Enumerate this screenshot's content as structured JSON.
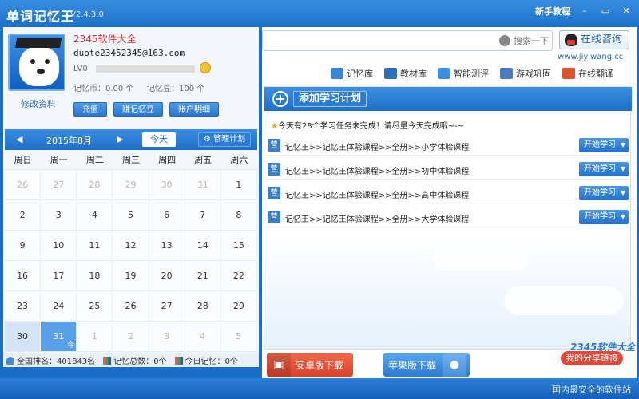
{
  "window": {
    "title": "单词记忆王",
    "version": "V2.4.3.0",
    "tutorial_link": "新手教程",
    "controls": [
      "–",
      "▭",
      "✕"
    ]
  },
  "profile": {
    "username": "2345软件大全",
    "email": "duote23452345@163.com",
    "level_label": "LV0",
    "level_progress": 0.0,
    "coins_label": "记忆币：",
    "coins_value": "0.00 个",
    "beans_label": "记忆豆：",
    "beans_value": "100 个",
    "edit_link": "修改资料",
    "buttons": {
      "recharge": "充值",
      "earn": "赚记忆豆",
      "account": "账户明细"
    }
  },
  "calendar": {
    "prev": "◀",
    "next": "▶",
    "month": "2015年8月",
    "today_button": "今天",
    "manage_button": "管理计划",
    "weekdays": [
      "周日",
      "周一",
      "周二",
      "周三",
      "周四",
      "周五",
      "周六"
    ],
    "days": [
      {
        "d": "26",
        "muted": true
      },
      {
        "d": "27",
        "muted": true
      },
      {
        "d": "28",
        "muted": true
      },
      {
        "d": "29",
        "muted": true
      },
      {
        "d": "30",
        "muted": true
      },
      {
        "d": "31",
        "muted": true
      },
      {
        "d": "1"
      },
      {
        "d": "2"
      },
      {
        "d": "3"
      },
      {
        "d": "4"
      },
      {
        "d": "5"
      },
      {
        "d": "6"
      },
      {
        "d": "7"
      },
      {
        "d": "8"
      },
      {
        "d": "9"
      },
      {
        "d": "10"
      },
      {
        "d": "11"
      },
      {
        "d": "12"
      },
      {
        "d": "13"
      },
      {
        "d": "14"
      },
      {
        "d": "15"
      },
      {
        "d": "16"
      },
      {
        "d": "17"
      },
      {
        "d": "18"
      },
      {
        "d": "19"
      },
      {
        "d": "20"
      },
      {
        "d": "21"
      },
      {
        "d": "22"
      },
      {
        "d": "23"
      },
      {
        "d": "24"
      },
      {
        "d": "25"
      },
      {
        "d": "26"
      },
      {
        "d": "27"
      },
      {
        "d": "28"
      },
      {
        "d": "29"
      },
      {
        "d": "30",
        "sel": true
      },
      {
        "d": "31",
        "today": true
      },
      {
        "d": "1",
        "muted": true
      },
      {
        "d": "2",
        "muted": true
      },
      {
        "d": "3",
        "muted": true
      },
      {
        "d": "4",
        "muted": true
      },
      {
        "d": "5",
        "muted": true
      }
    ]
  },
  "stats": {
    "rank_label": "全国排名：",
    "rank_value": "401843名",
    "total_label": "记忆总数：",
    "total_value": "0个",
    "today_label": "今日记忆：",
    "today_value": "0个"
  },
  "search": {
    "placeholder": "",
    "button": "搜索一下"
  },
  "consult_button": "在线咨询",
  "site_url": "www.jiyiwang.cc",
  "nav": [
    {
      "label": "记忆库",
      "icon": "chart-icon",
      "color": "#3a86d6"
    },
    {
      "label": "教材库",
      "icon": "book-icon",
      "color": "#2f6fb8"
    },
    {
      "label": "智能测评",
      "icon": "thumb-icon",
      "color": "#3b8fe0"
    },
    {
      "label": "游戏巩固",
      "icon": "gamepad-icon",
      "color": "#4a7bc0"
    },
    {
      "label": "在线翻译",
      "icon": "person-icon",
      "color": "#d9542e"
    }
  ],
  "plan": {
    "add_button": "添加学习计划",
    "notice_star": "★",
    "notice": "今天有28个学习任务未完成！请尽量今天完成哦~-~",
    "rows": [
      {
        "tag": "营",
        "path": "记忆王>>记忆王体验课程>>全册>>小学体验课程",
        "button": "开始学习"
      },
      {
        "tag": "营",
        "path": "记忆王>>记忆王体验课程>>全册>>初中体验课程",
        "button": "开始学习"
      },
      {
        "tag": "营",
        "path": "记忆王>>记忆王体验课程>>全册>>高中体验课程",
        "button": "开始学习"
      },
      {
        "tag": "营",
        "path": "记忆王>>记忆王体验课程>>全册>>大学体验课程",
        "button": "开始学习"
      }
    ]
  },
  "downloads": {
    "android": "安卓版下载",
    "apple": "苹果版下载"
  },
  "share_badge": "我的分享链接",
  "footer_note": "国内最安全的软件站",
  "logo_stamp": "2345软件大全"
}
